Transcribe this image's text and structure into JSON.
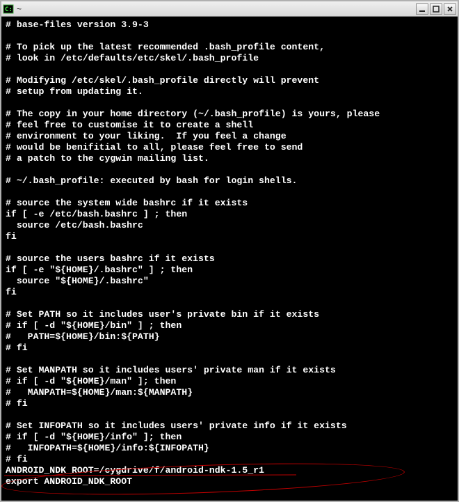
{
  "window": {
    "title": "~"
  },
  "terminal": {
    "lines": [
      "# base-files version 3.9-3",
      "",
      "# To pick up the latest recommended .bash_profile content,",
      "# look in /etc/defaults/etc/skel/.bash_profile",
      "",
      "# Modifying /etc/skel/.bash_profile directly will prevent",
      "# setup from updating it.",
      "",
      "# The copy in your home directory (~/.bash_profile) is yours, please",
      "# feel free to customise it to create a shell",
      "# environment to your liking.  If you feel a change",
      "# would be benifitial to all, please feel free to send",
      "# a patch to the cygwin mailing list.",
      "",
      "# ~/.bash_profile: executed by bash for login shells.",
      "",
      "# source the system wide bashrc if it exists",
      "if [ -e /etc/bash.bashrc ] ; then",
      "  source /etc/bash.bashrc",
      "fi",
      "",
      "# source the users bashrc if it exists",
      "if [ -e \"${HOME}/.bashrc\" ] ; then",
      "  source \"${HOME}/.bashrc\"",
      "fi",
      "",
      "# Set PATH so it includes user's private bin if it exists",
      "# if [ -d \"${HOME}/bin\" ] ; then",
      "#   PATH=${HOME}/bin:${PATH}",
      "# fi",
      "",
      "# Set MANPATH so it includes users' private man if it exists",
      "# if [ -d \"${HOME}/man\" ]; then",
      "#   MANPATH=${HOME}/man:${MANPATH}",
      "# fi",
      "",
      "# Set INFOPATH so it includes users' private info if it exists",
      "# if [ -d \"${HOME}/info\" ]; then",
      "#   INFOPATH=${HOME}/info:${INFOPATH}",
      "# fi",
      "ANDROID_NDK_ROOT=/cygdrive/f/android-ndk-1.5_r1",
      "export ANDROID_NDK_ROOT"
    ]
  }
}
